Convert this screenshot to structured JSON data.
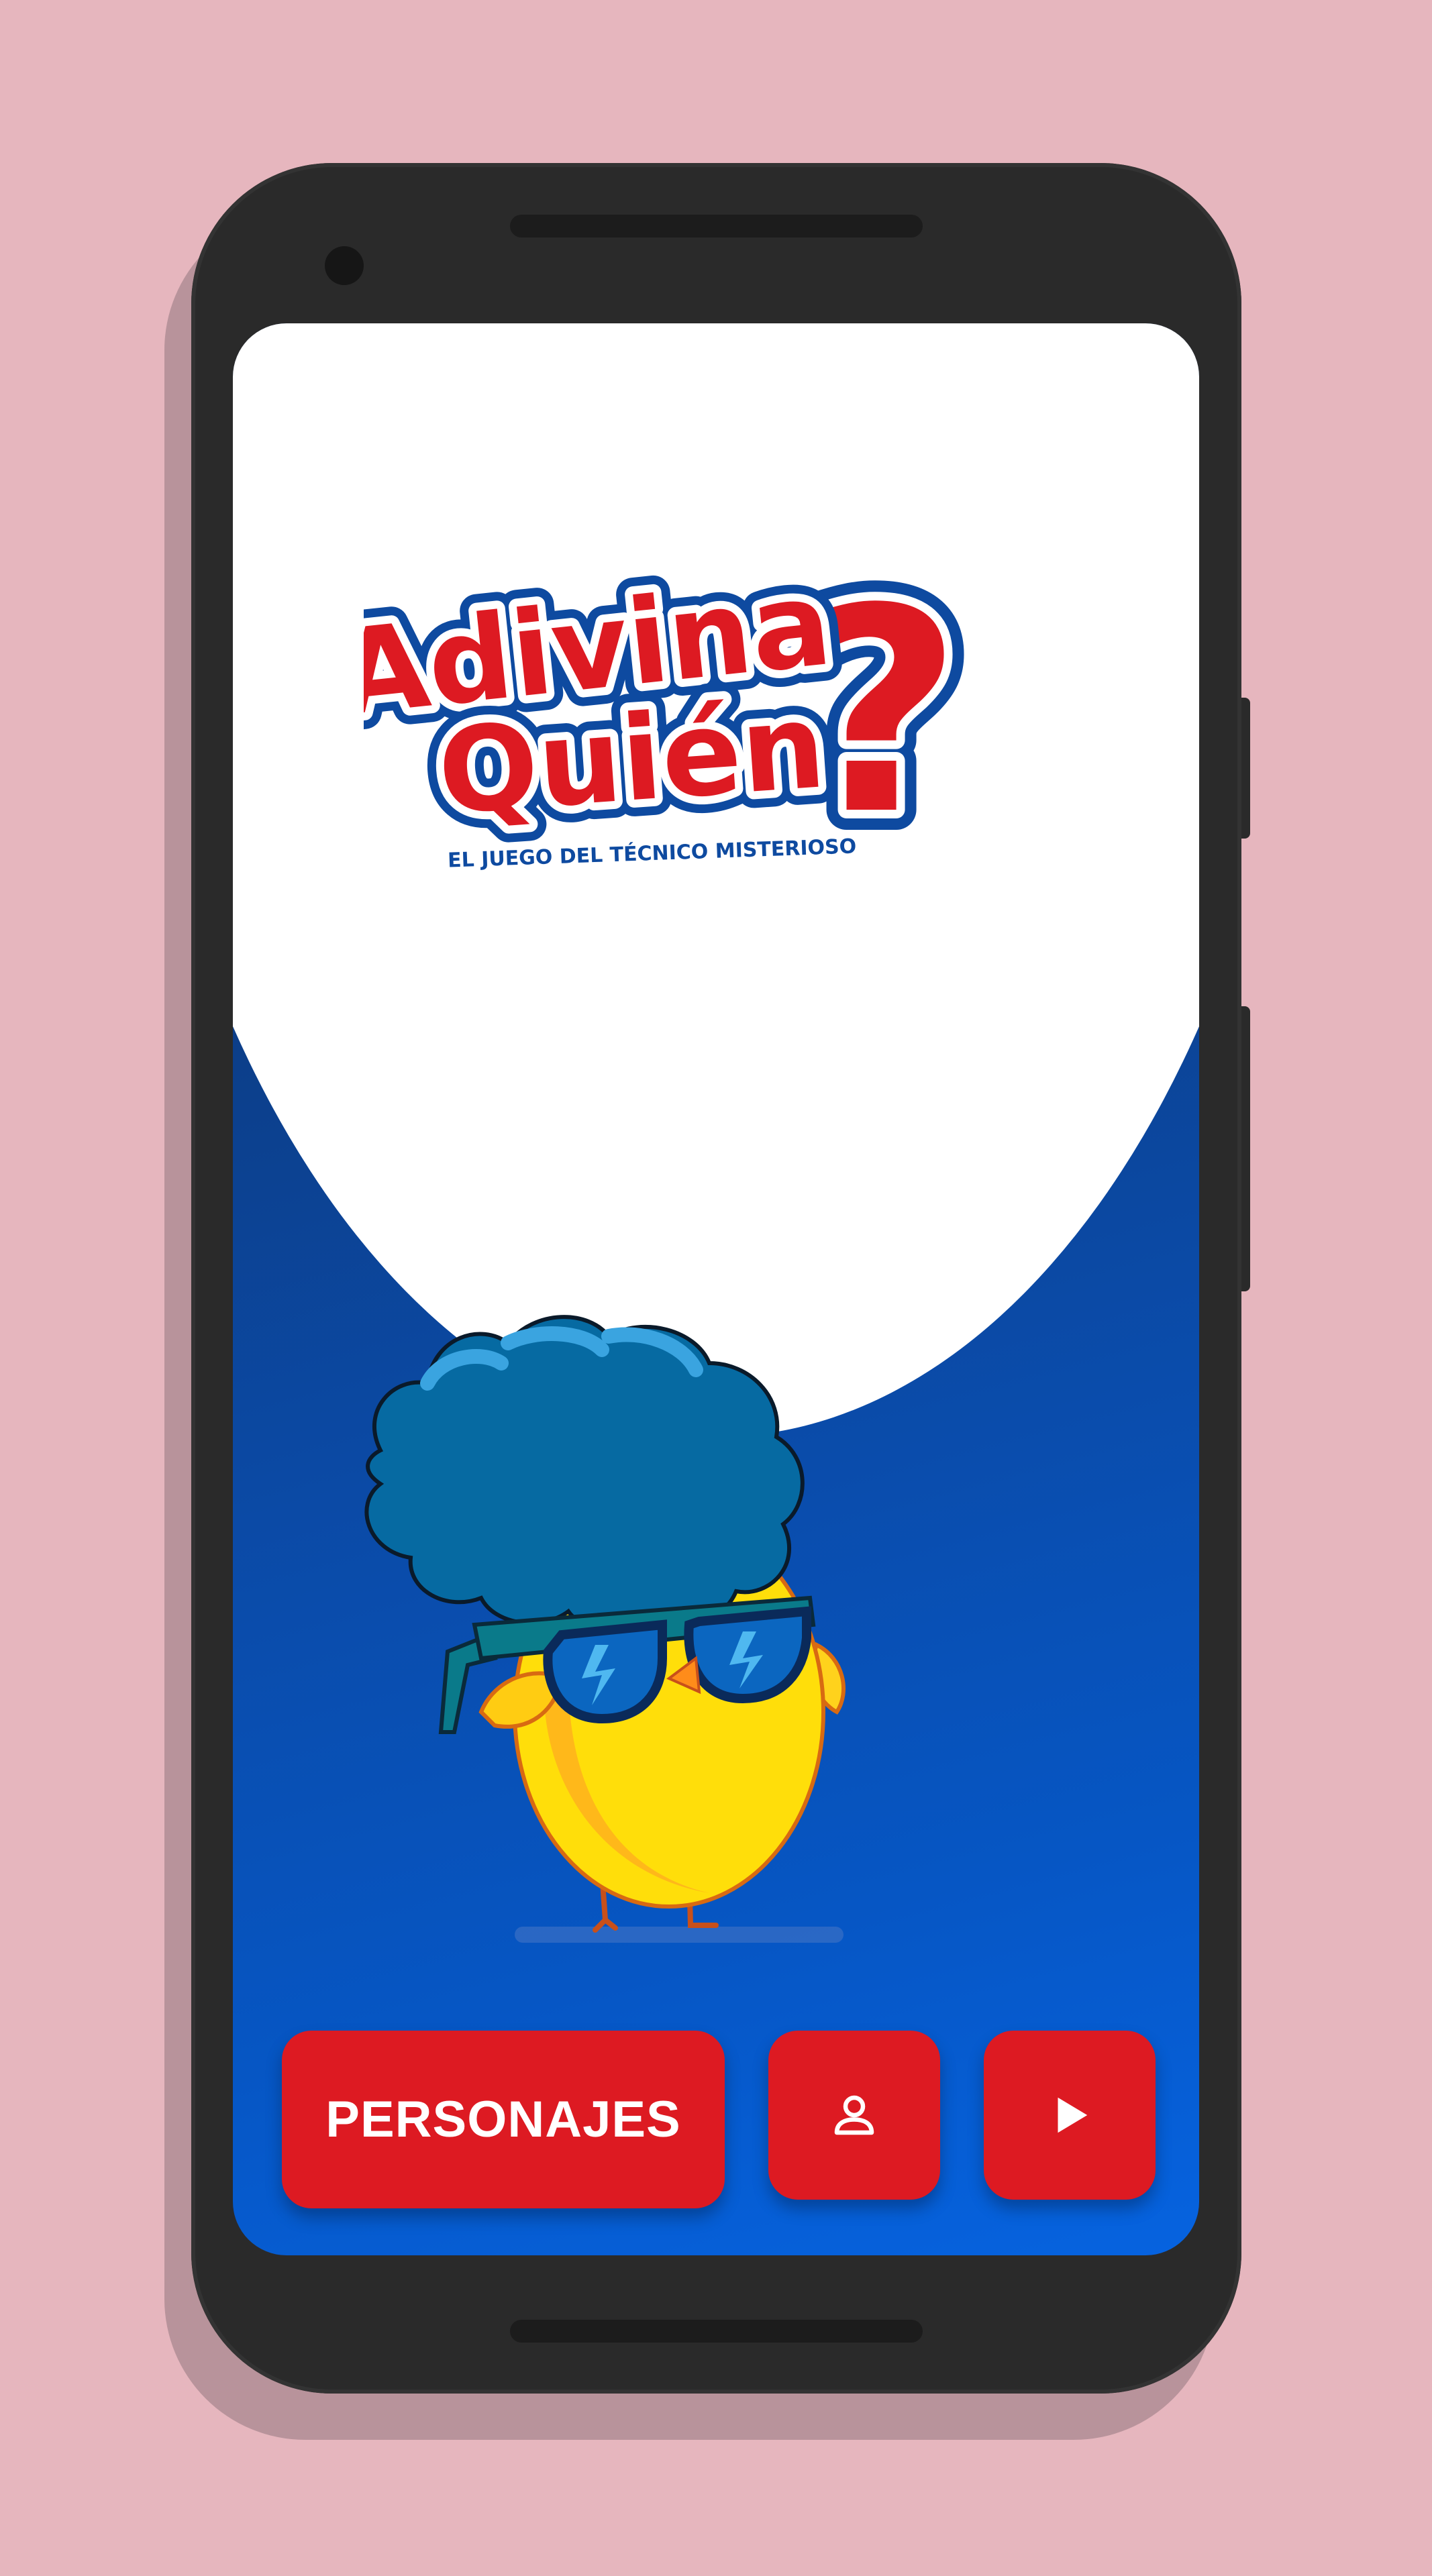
{
  "app": {
    "logo": {
      "line1": "Adivina",
      "line2": "Quién",
      "mark": "?",
      "tagline": "EL JUEGO DEL TÉCNICO MISTERIOSO"
    },
    "buttons": {
      "personajes_label": "PERSONAJES",
      "profile_icon": "user-icon",
      "play_icon": "play-icon"
    }
  },
  "colors": {
    "background": "#e6b6be",
    "phone": "#2a2a2a",
    "accent_red": "#dd1a22",
    "logo_blue": "#0e4aa0",
    "screen_blue_dark": "#0a2a5a",
    "screen_blue_light": "#0663e0"
  }
}
